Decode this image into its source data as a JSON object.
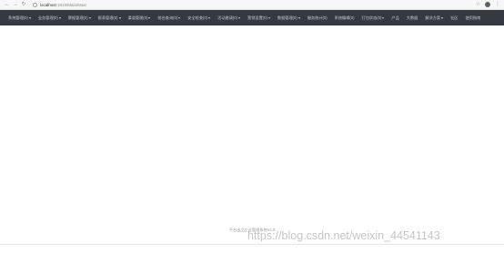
{
  "browser": {
    "url_host": "localhost",
    "url_path": ":1919/Main/Main"
  },
  "navbar": {
    "items": [
      {
        "label": "系统管理(0)",
        "dropdown": true
      },
      {
        "label": "业务管理(0)",
        "dropdown": true
      },
      {
        "label": "票据管理(0)",
        "dropdown": true
      },
      {
        "label": "报表管理(0)",
        "dropdown": true
      },
      {
        "label": "渠道管理(0)",
        "dropdown": true
      },
      {
        "label": "前台查询(0)",
        "dropdown": true
      },
      {
        "label": "安全检查(0)",
        "dropdown": true
      },
      {
        "label": "活动邀请(0)",
        "dropdown": true
      },
      {
        "label": "营销设置(0)",
        "dropdown": true
      },
      {
        "label": "数据管理(0)",
        "dropdown": true
      },
      {
        "label": "服务统计(0)",
        "dropdown": false
      },
      {
        "label": "系统编辑(0)",
        "dropdown": false
      },
      {
        "label": "打包状态(0)",
        "dropdown": true
      },
      {
        "label": "产品",
        "dropdown": false
      },
      {
        "label": "大数据",
        "dropdown": false
      },
      {
        "label": "解决方案",
        "dropdown": true
      },
      {
        "label": "社区",
        "dropdown": false
      },
      {
        "label": "使用指南",
        "dropdown": false
      }
    ]
  },
  "footer": {
    "text": "平台出品企业管理系统V1.0"
  },
  "watermark": "https://blog.csdn.net/weixin_44541143"
}
